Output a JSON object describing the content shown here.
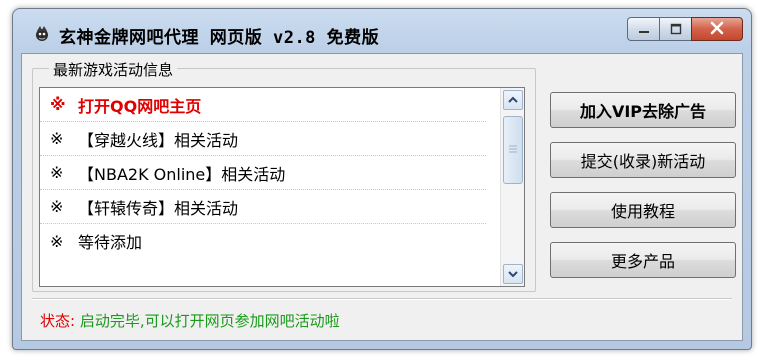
{
  "window": {
    "title": "玄神金牌网吧代理 网页版 v2.8 免费版"
  },
  "icons": {
    "app": "app-logo-icon",
    "minimize": "minimize-icon",
    "maximize": "maximize-icon",
    "close": "close-icon",
    "scroll_up": "chevron-up-icon",
    "scroll_down": "chevron-down-icon"
  },
  "group": {
    "label": "最新游戏活动信息"
  },
  "list": {
    "marker": "※",
    "items": [
      "打开QQ网吧主页",
      "【穿越火线】相关活动",
      "【NBA2K Online】相关活动",
      "【轩辕传奇】相关活动",
      "等待添加"
    ]
  },
  "buttons": {
    "remove_ads": "加入VIP去除广告",
    "submit_activity": "提交(收录)新活动",
    "tutorial": "使用教程",
    "more_products": "更多产品"
  },
  "status": {
    "key": "状态:",
    "value": "启动完毕,可以打开网页参加网吧活动啦"
  },
  "colors": {
    "first_item": "#e00000",
    "status_key": "#e00000",
    "status_value": "#1a9a1a",
    "close_button": "#c4472e"
  }
}
